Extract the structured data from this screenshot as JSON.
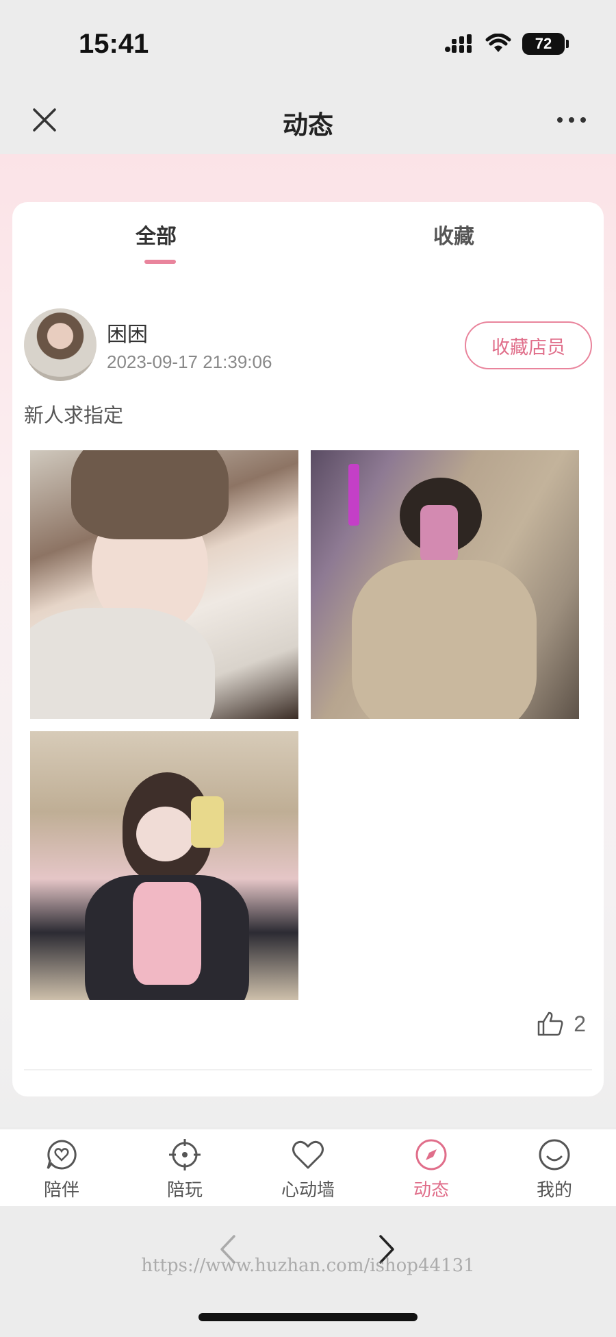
{
  "status_bar": {
    "time": "15:41",
    "battery": "72"
  },
  "nav": {
    "title": "动态"
  },
  "tabs": {
    "all": "全部",
    "favorites": "收藏"
  },
  "post": {
    "user_name": "困困",
    "time": "2023-09-17 21:39:06",
    "follow_button": "收藏店员",
    "text": "新人求指定",
    "likes": "2",
    "photo_count": 3
  },
  "bottom_tabs": [
    {
      "label": "陪伴",
      "icon": "heart-chat-icon",
      "active": false
    },
    {
      "label": "陪玩",
      "icon": "crosshair-icon",
      "active": false
    },
    {
      "label": "心动墙",
      "icon": "heart-icon",
      "active": false
    },
    {
      "label": "动态",
      "icon": "compass-icon",
      "active": true
    },
    {
      "label": "我的",
      "icon": "smile-icon",
      "active": false
    }
  ],
  "watermark": "https://www.huzhan.com/ishop44131",
  "colors": {
    "accent": "#e06e8a",
    "background": "#ececec",
    "pink": "#fbe3e7"
  }
}
